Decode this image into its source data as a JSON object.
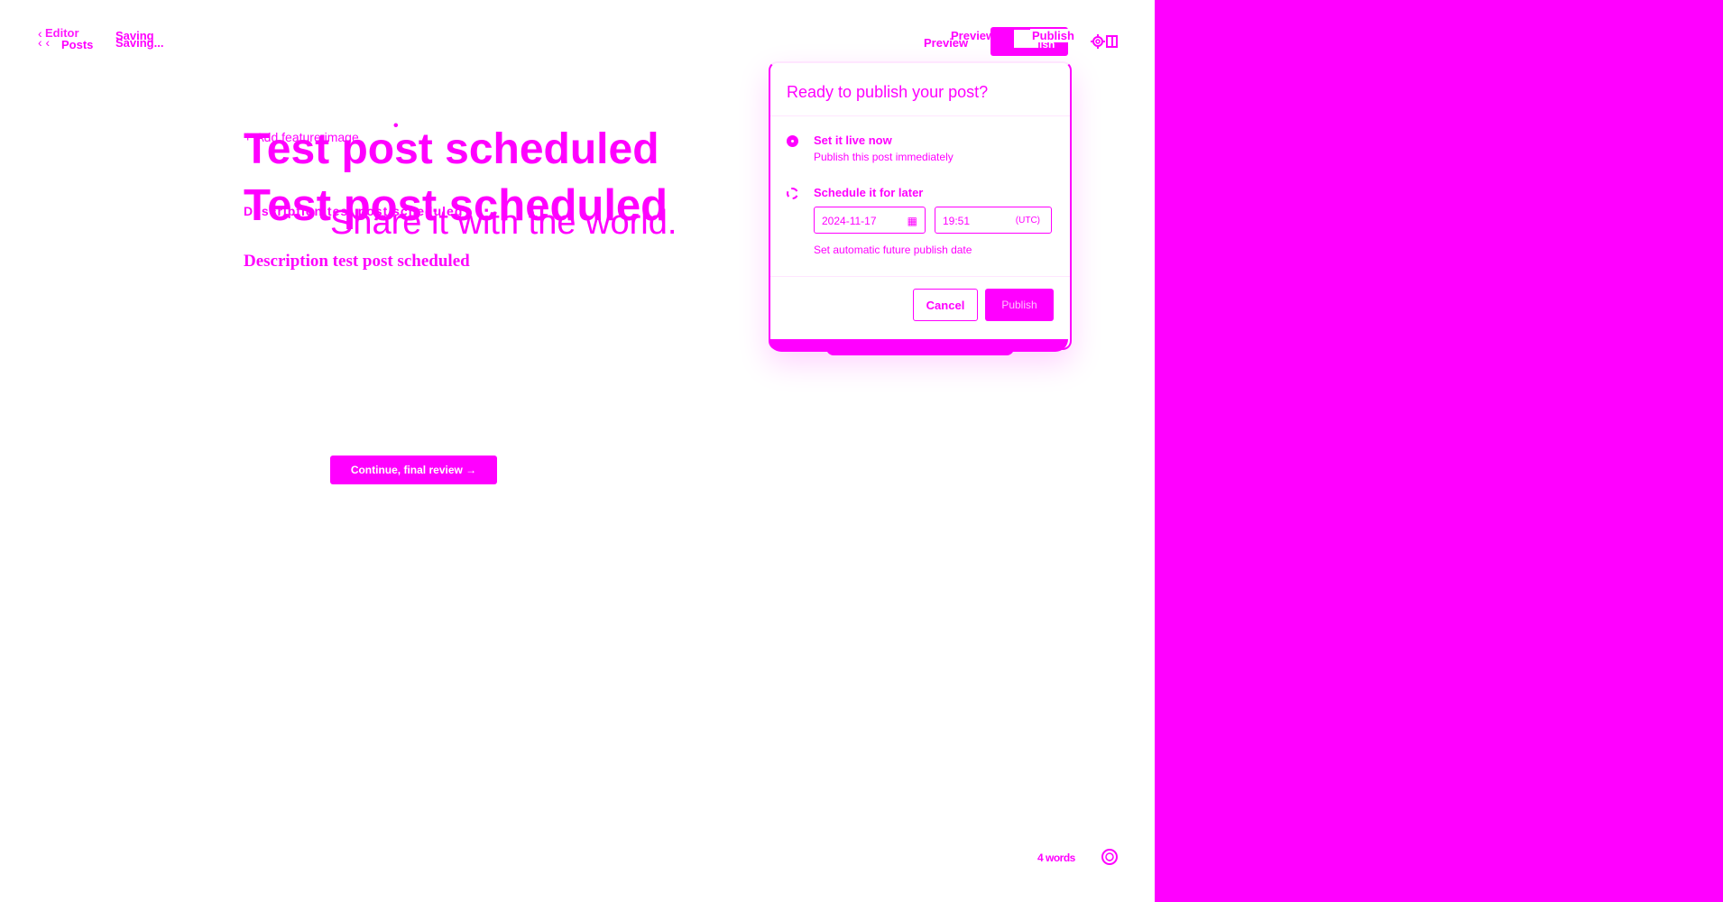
{
  "header": {
    "back_ghost": "Editor",
    "back_label": "Posts",
    "saving_ghost": "Saving",
    "saving_label": "Saving...",
    "preview_label": "Preview",
    "preview_ghost": "Preview",
    "publish_label": "Publish",
    "publish_ghost": "Publish"
  },
  "publish_popover": {
    "title": "Ready to publish your post?",
    "options": [
      {
        "label": "Set it live now",
        "description": "Publish this post immediately",
        "selected": true
      },
      {
        "label": "Schedule it for later",
        "description": "",
        "selected": false
      }
    ],
    "date_value": "2024-11-17",
    "time_value": "19:51",
    "timezone": "(UTC)",
    "hint": "Set automatic future publish date",
    "cancel_label": "Cancel",
    "publish_label": "Publish"
  },
  "editor": {
    "feature_image_label": "Add feature image",
    "title": "Test post scheduled",
    "title_ghost": "Test post scheduled",
    "excerpt_ghost": "Description test post scheduled",
    "share_text": "Share it with the world.",
    "description": "Description test post scheduled",
    "continue_label": "Continue, final review →"
  },
  "footer": {
    "word_count": "4 words"
  },
  "colors": {
    "accent": "#ff00ff",
    "background": "#ffffff"
  },
  "icons": [
    "chevron-left-icon",
    "gear-icon",
    "sidebar-toggle-icon",
    "calendar-icon",
    "help-icon",
    "plus-icon"
  ]
}
